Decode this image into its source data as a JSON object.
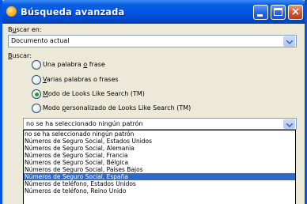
{
  "window": {
    "title": "Búsqueda avanzada",
    "buttons": [
      "minimize",
      "maximize",
      "close"
    ]
  },
  "search_in": {
    "label": "Buscar en:",
    "value": "Documento actual"
  },
  "search": {
    "label": "Buscar:",
    "options": [
      {
        "label": "Una palabra o frase",
        "selected": false
      },
      {
        "label": "Varias palabras o frases",
        "selected": false
      },
      {
        "label": "Modo de Looks Like Search (TM)",
        "selected": true
      },
      {
        "label": "Modo personalizado de Looks Like Search (TM)",
        "selected": false
      }
    ]
  },
  "pattern": {
    "value": "no se ha seleccionado ningún patrón",
    "options": [
      "no se ha seleccionado ningún patrón",
      "Números de Seguro Social, Estados Unidos",
      "Números de Seguro Social, Alemania",
      "Números de Seguro Social, Francia",
      "Números de Seguro Social, Bélgica",
      "Números de Seguro Social, Países Bajos",
      "Números de Seguro Social, España",
      "Números de teléfono, Estados Unidos",
      "Números de teléfono, Reino Unido"
    ],
    "highlighted_index": 6
  },
  "colors": {
    "titlebar": "#0054e3",
    "dialog_bg": "#ece9d8",
    "selection": "#316ac5",
    "radio_dot": "#21a121",
    "close_button": "#d8502c"
  }
}
